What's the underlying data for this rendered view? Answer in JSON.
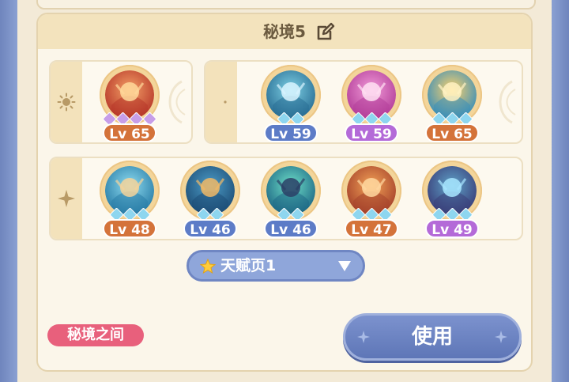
{
  "panel": {
    "title": "秘境5",
    "edit_icon": "edit-icon"
  },
  "rows": [
    {
      "element_icon": "sun-icon",
      "heroes": [
        {
          "level": "Lv 65",
          "badge_color": "#d4733a",
          "stars": 4,
          "star_color": "#c79ee8",
          "theme": "fire"
        }
      ]
    },
    {
      "element_icon": "moon-icon",
      "heroes": [
        {
          "level": "Lv 59",
          "badge_color": "#5d7cc7",
          "stars": 2,
          "star_color": "#8ed6ef",
          "theme": "ice"
        },
        {
          "level": "Lv 59",
          "badge_color": "#b46ad8",
          "stars": 3,
          "star_color": "#8ed6ef",
          "theme": "pink"
        },
        {
          "level": "Lv 65",
          "badge_color": "#d4733a",
          "stars": 3,
          "star_color": "#8ed6ef",
          "theme": "shield"
        }
      ]
    },
    {
      "element_icon": "sparkle-icon",
      "heroes": [
        {
          "level": "Lv 48",
          "badge_color": "#d4733a",
          "stars": 3,
          "star_color": "#8ed6ef",
          "theme": "wind"
        },
        {
          "level": "Lv 46",
          "badge_color": "#5d7cc7",
          "stars": 2,
          "star_color": "#8ed6ef",
          "theme": "warrior"
        },
        {
          "level": "Lv 46",
          "badge_color": "#5d7cc7",
          "stars": 2,
          "star_color": "#8ed6ef",
          "theme": "sword"
        },
        {
          "level": "Lv 47",
          "badge_color": "#d4733a",
          "stars": 3,
          "star_color": "#8ed6ef",
          "theme": "cross"
        },
        {
          "level": "Lv 49",
          "badge_color": "#b46ad8",
          "stars": 3,
          "star_color": "#8ed6ef",
          "theme": "night"
        }
      ]
    }
  ],
  "talent_select": {
    "label": "天赋页1",
    "star_icon": "star-icon",
    "arrow_icon": "triangle-down-icon"
  },
  "realm_badge": {
    "label": "秘境之间"
  },
  "use_button": {
    "label": "使用"
  },
  "colors": {
    "orange_badge": "#d4733a",
    "blue_badge": "#5d7cc7",
    "purple_badge": "#b46ad8",
    "pink_badge": "#e8607c",
    "button_blue": "#6c83c2"
  }
}
